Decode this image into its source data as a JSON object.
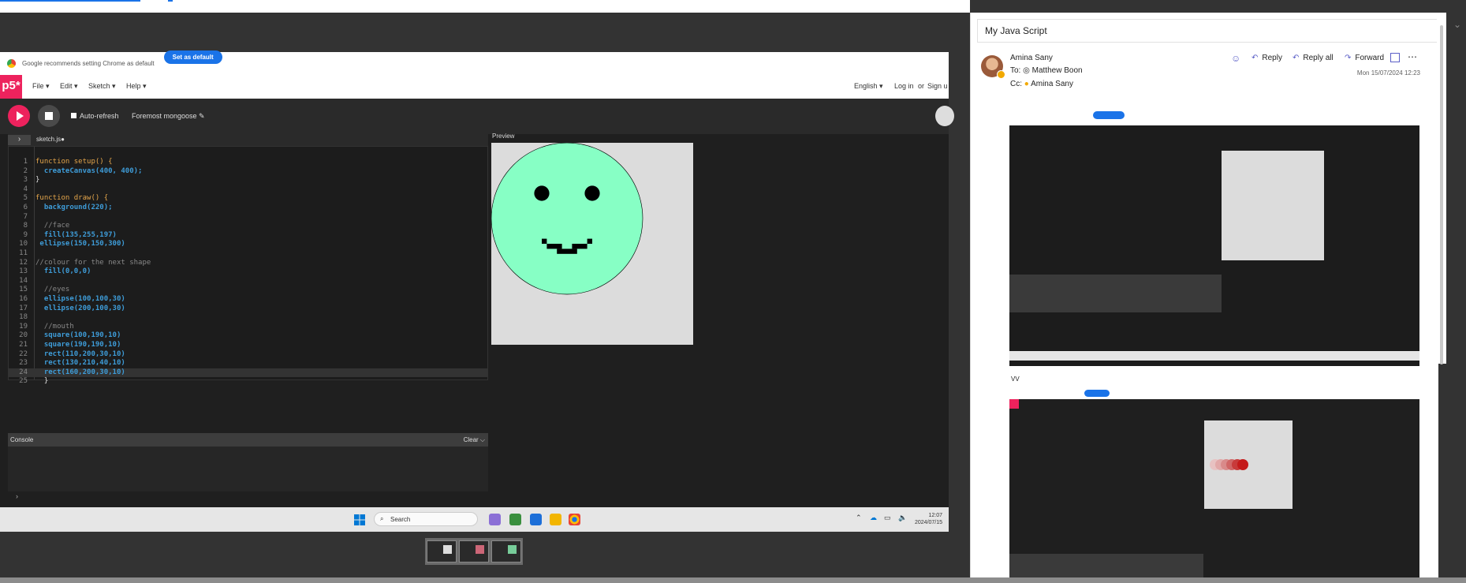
{
  "chrome_notice": {
    "text": "Google recommends setting Chrome as default",
    "button": "Set as default"
  },
  "p5": {
    "logo": "p5*",
    "menu": [
      "File ▾",
      "Edit ▾",
      "Sketch ▾",
      "Help ▾"
    ],
    "language": "English ▾",
    "login": "Log in",
    "or": "or",
    "signup": "Sign u",
    "auto_refresh": "Auto-refresh",
    "sketch_name": "Foremost mongoose ✎",
    "file_tab": "sketch.js●",
    "preview_label": "Preview",
    "console_label": "Console",
    "console_clear": "Clear ⌵",
    "console_prompt": "›",
    "code_lines": [
      "function setup() {",
      "  createCanvas(400, 400);",
      "}",
      "",
      "function draw() {",
      "  background(220);",
      "",
      "  //face",
      "  fill(135,255,197)",
      " ellipse(150,150,300)",
      "",
      "//colour for the next shape",
      "  fill(0,0,0)",
      "",
      "  //eyes",
      "  ellipse(100,100,30)",
      "  ellipse(200,100,30)",
      "",
      "  //mouth",
      "  square(100,190,10)",
      "  square(190,190,10)",
      "  rect(110,200,30,10)",
      "  rect(130,210,40,10)",
      "  rect(160,200,30,10)",
      "  }"
    ],
    "face_color": "#87ffc5"
  },
  "taskbar": {
    "search": "Search",
    "time": "12:07",
    "date": "2024/07/15"
  },
  "email": {
    "subject": "My Java Script",
    "sender": "Amina Sany",
    "to_label": "To:",
    "to": "Matthew Boon",
    "cc_label": "Cc:",
    "cc": "Amina Sany",
    "date": "Mon 15/07/2024 12:23",
    "actions": {
      "reply": "Reply",
      "reply_all": "Reply all",
      "forward": "Forward"
    },
    "body_note": "VV"
  },
  "colors": {
    "p5_pink": "#ed225d",
    "outlook_accent": "#5b5fc7",
    "chrome_blue": "#1a73e8"
  }
}
